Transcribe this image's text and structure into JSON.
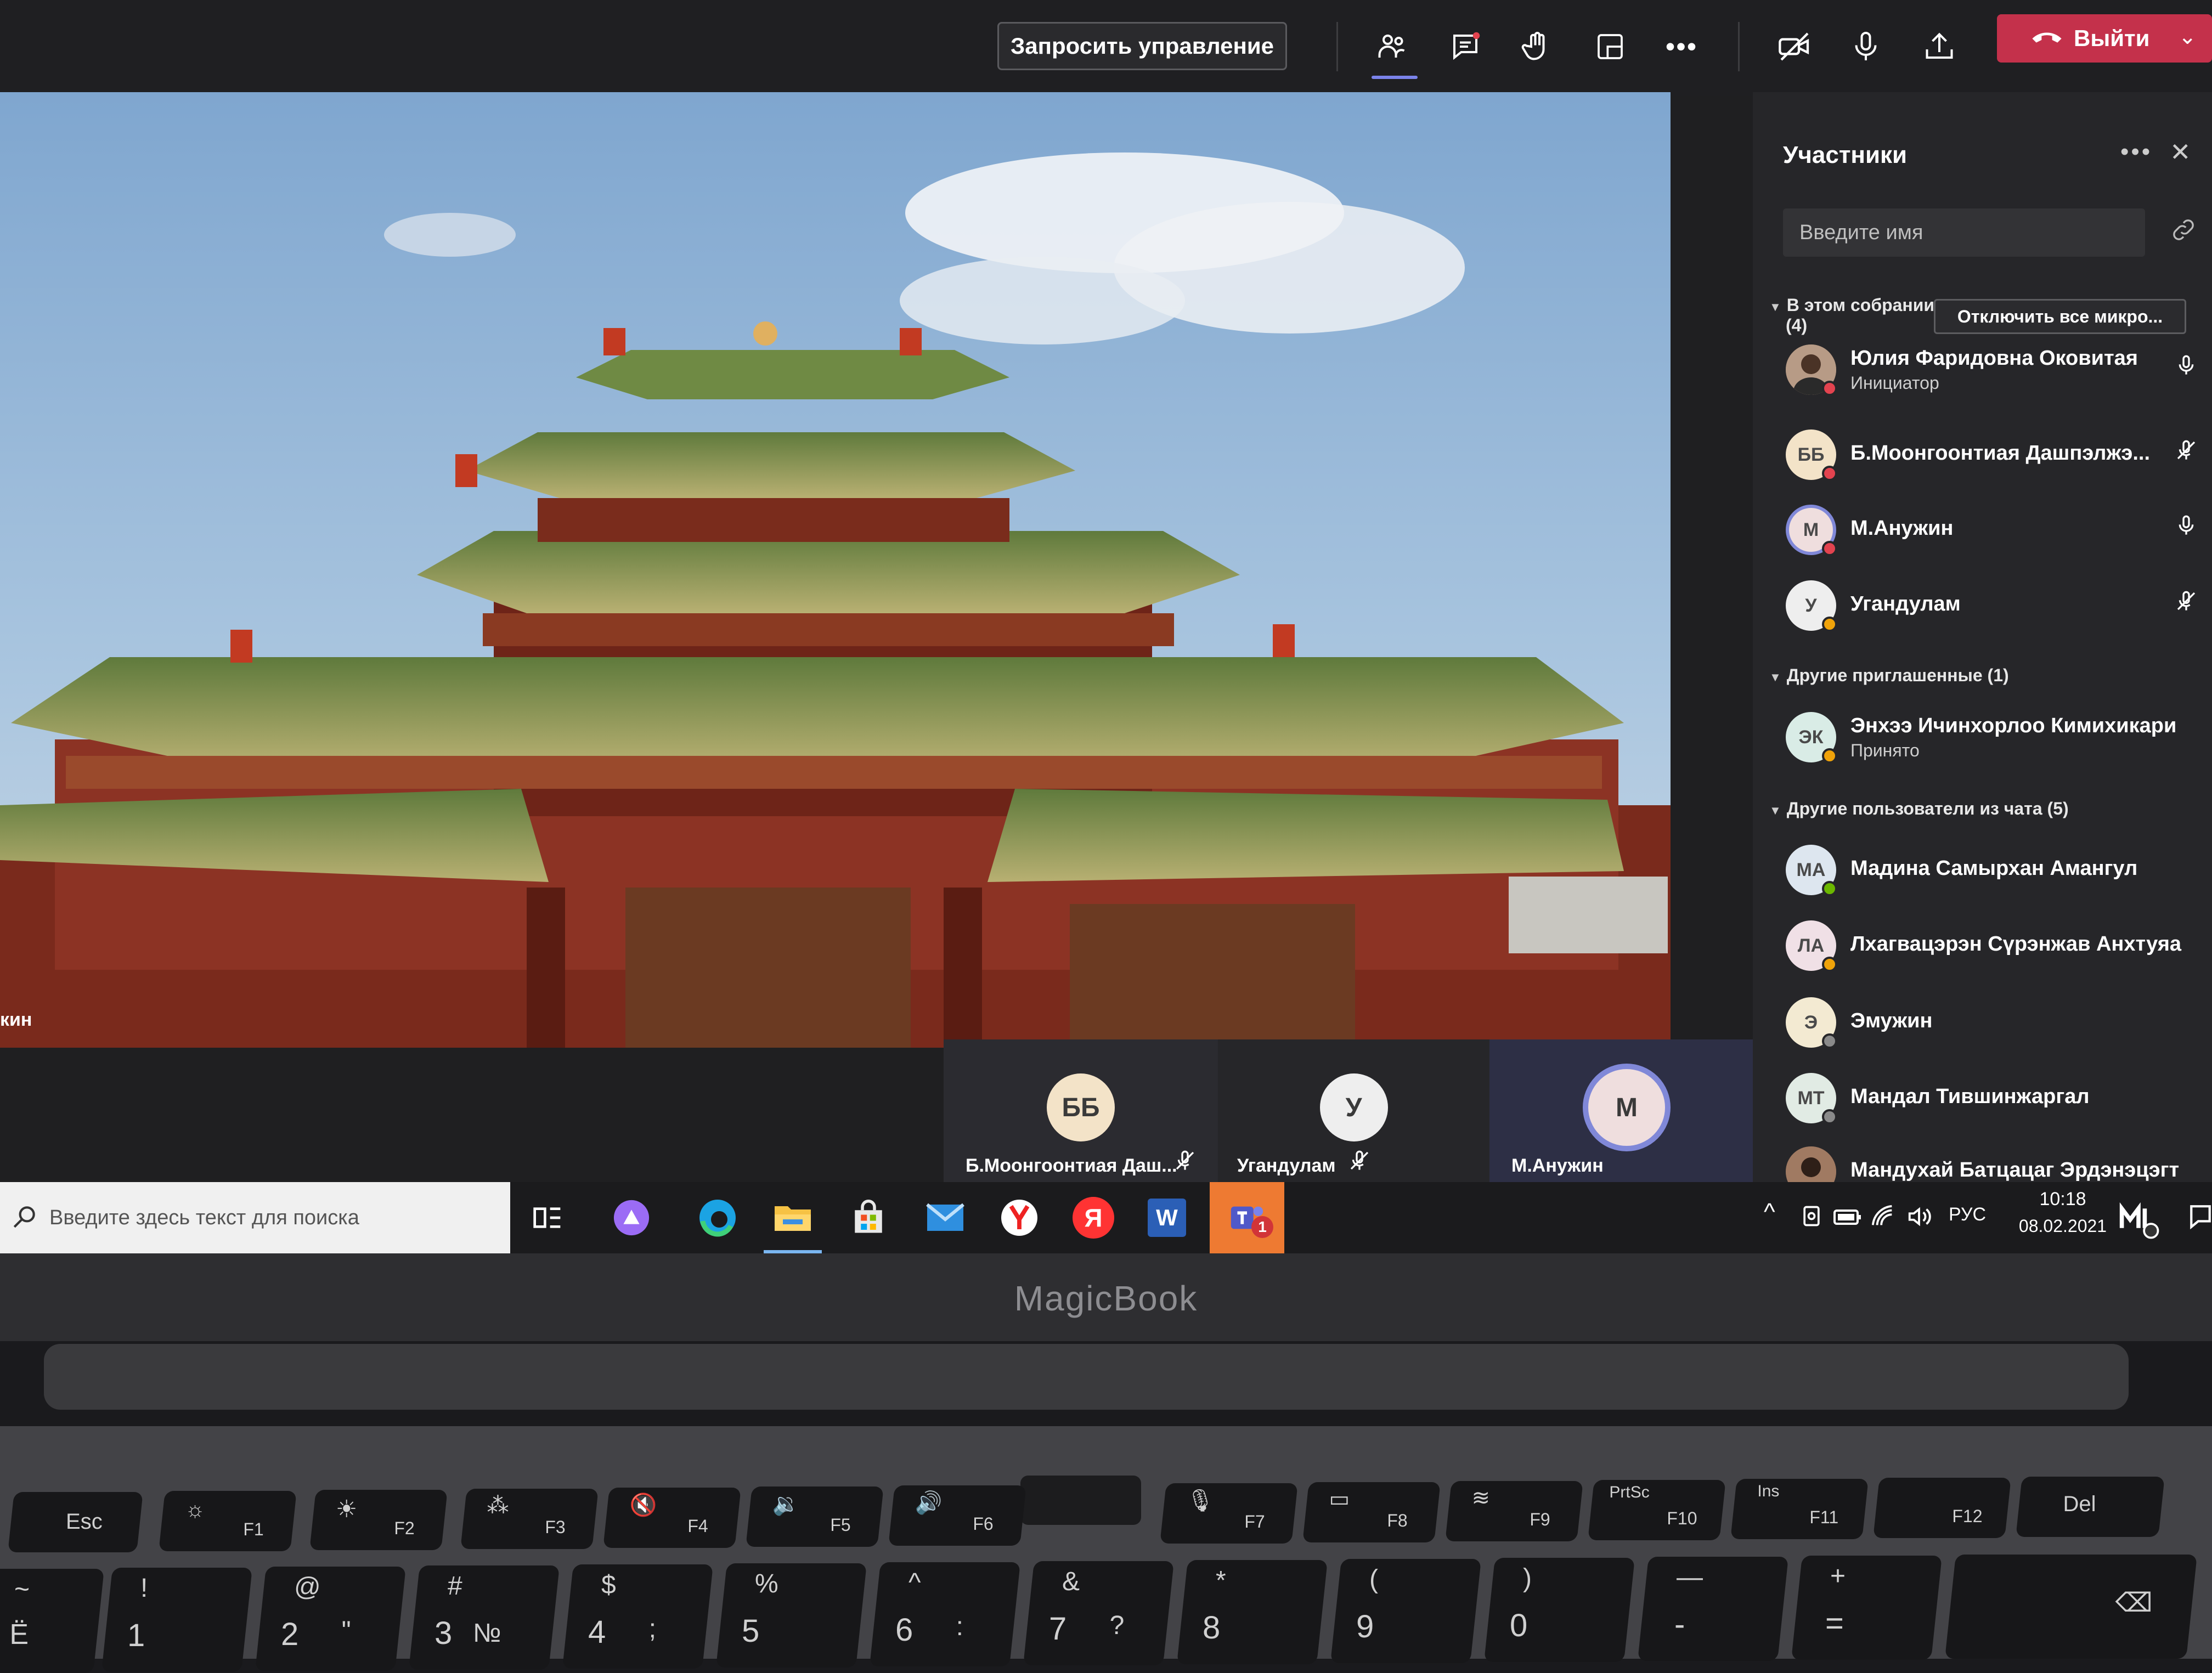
{
  "toolbar": {
    "request_control_label": "Запросить управление",
    "leave_label": "Выйти"
  },
  "shared_video": {
    "tile_label": "кин"
  },
  "strip": [
    {
      "initials": "ББ",
      "name": "Б.Моонгоонтиая Даш...",
      "muted": true,
      "color": "#f3e3c8"
    },
    {
      "initials": "У",
      "name": "Угандулам",
      "muted": true,
      "color": "#eeeeee"
    },
    {
      "initials": "М",
      "name": "М.Анужин",
      "muted": false,
      "color": "#efdede"
    }
  ],
  "panel": {
    "title": "Участники",
    "search_placeholder": "Введите имя",
    "in_meeting_label": "В этом собрании",
    "in_meeting_count": "(4)",
    "mute_all_label": "Отключить все микро...",
    "in_meeting": [
      {
        "name": "Юлия Фаридовна Оковитая",
        "role": "Инициатор",
        "initials": "",
        "avatar": "photo"
      },
      {
        "name": "Б.Моонгоонтиая Дашпэлжэ...",
        "initials": "ББ",
        "avatar": "#f3e3c8"
      },
      {
        "name": "М.Анужин",
        "initials": "М",
        "avatar": "#efdede"
      },
      {
        "name": "Угандулам",
        "initials": "У",
        "avatar": "#eeeeee"
      }
    ],
    "others_invited_label": "Другие приглашенные (1)",
    "others_invited": [
      {
        "name": "Энхээ Ичинхорлоо Кимихикари",
        "status": "Принято",
        "initials": "ЭК",
        "avatar": "#d9ece6"
      }
    ],
    "chat_users_label": "Другие пользователи из чата (5)",
    "chat_users": [
      {
        "name": "Мадина Самырхан Амангул",
        "initials": "МА",
        "avatar": "#dde6ef"
      },
      {
        "name": "Лхагвацэрэн Сүрэнжав Анхтуяа",
        "initials": "ЛА",
        "avatar": "#f0e0e6"
      },
      {
        "name": "Эмужин",
        "initials": "Э",
        "avatar": "#f3ead2"
      },
      {
        "name": "Мандал Тившинжаргал",
        "initials": "МТ",
        "avatar": "#e1ebe4"
      },
      {
        "name": "Мандухай Батцацаг Эрдэнэцэгт",
        "initials": "",
        "avatar": "photo"
      }
    ]
  },
  "taskbar": {
    "search_placeholder": "Введите здесь текст для поиска",
    "lang": "РУС",
    "time": "10:18",
    "date": "08.02.2021",
    "teams_badge": "1",
    "yandex_letter": "Я",
    "word_letter": "W"
  },
  "laptop": {
    "brand": "MagicBook",
    "fkeys": [
      "Esc",
      "F1",
      "F2",
      "F3",
      "F4",
      "F5",
      "F6",
      "F7",
      "F8",
      "F9",
      "F10",
      "F11",
      "F12",
      "Del"
    ],
    "fkey_extras": {
      "f10": "PrtSc",
      "f11": "Ins"
    },
    "number_keys": [
      {
        "top": "~",
        "bottom": "Ё"
      },
      {
        "top": "!",
        "bottom": "1"
      },
      {
        "top": "@",
        "bottom": "2"
      },
      {
        "top": "#",
        "bottom": "3"
      },
      {
        "top": "$",
        "bottom": "4"
      },
      {
        "top": "%",
        "bottom": "5"
      },
      {
        "top": "^",
        "bottom": "6"
      },
      {
        "top": "&",
        "bottom": "7"
      },
      {
        "top": "*",
        "bottom": "8"
      },
      {
        "top": "(",
        "bottom": "9"
      },
      {
        "top": ")",
        "bottom": "0"
      },
      {
        "top": "—",
        "bottom": "-"
      },
      {
        "top": "+",
        "bottom": "="
      }
    ],
    "number_key_alts": [
      "",
      "",
      "\"",
      "№",
      ";",
      "",
      ":",
      "?",
      "",
      "",
      "",
      "",
      ""
    ]
  },
  "colors": {
    "teams_accent": "#7b83eb",
    "leave_red": "#c4314b",
    "status_busy": "#e3434f",
    "status_away": "#f0a30a",
    "status_available": "#6bb700"
  }
}
